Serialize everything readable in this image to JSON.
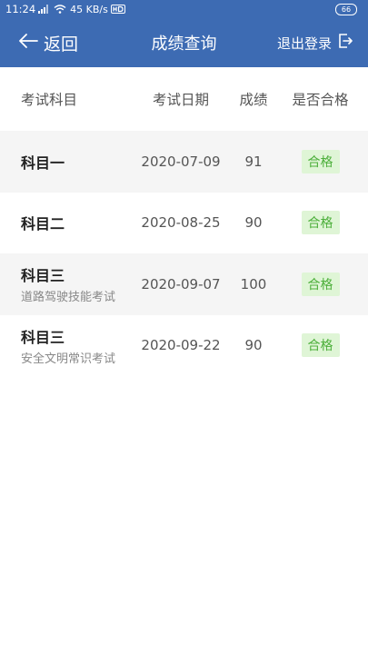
{
  "status": {
    "time": "11:24",
    "net_speed": "45 KB/s",
    "battery": "66"
  },
  "appbar": {
    "back_label": "返回",
    "title": "成绩查询",
    "logout_label": "退出登录"
  },
  "table": {
    "headers": {
      "subject": "考试科目",
      "date": "考试日期",
      "score": "成绩",
      "passed": "是否合格"
    },
    "rows": [
      {
        "subject": "科目一",
        "sub": "",
        "date": "2020-07-09",
        "score": "91",
        "passed": "合格"
      },
      {
        "subject": "科目二",
        "sub": "",
        "date": "2020-08-25",
        "score": "90",
        "passed": "合格"
      },
      {
        "subject": "科目三",
        "sub": "道路驾驶技能考试",
        "date": "2020-09-07",
        "score": "100",
        "passed": "合格"
      },
      {
        "subject": "科目三",
        "sub": "安全文明常识考试",
        "date": "2020-09-22",
        "score": "90",
        "passed": "合格"
      }
    ]
  },
  "colors": {
    "brand": "#3d6bb3",
    "pass_bg": "#dff5d6",
    "pass_text": "#4caf3a"
  },
  "icons": {
    "back": "arrow-left-icon",
    "logout": "logout-icon"
  }
}
